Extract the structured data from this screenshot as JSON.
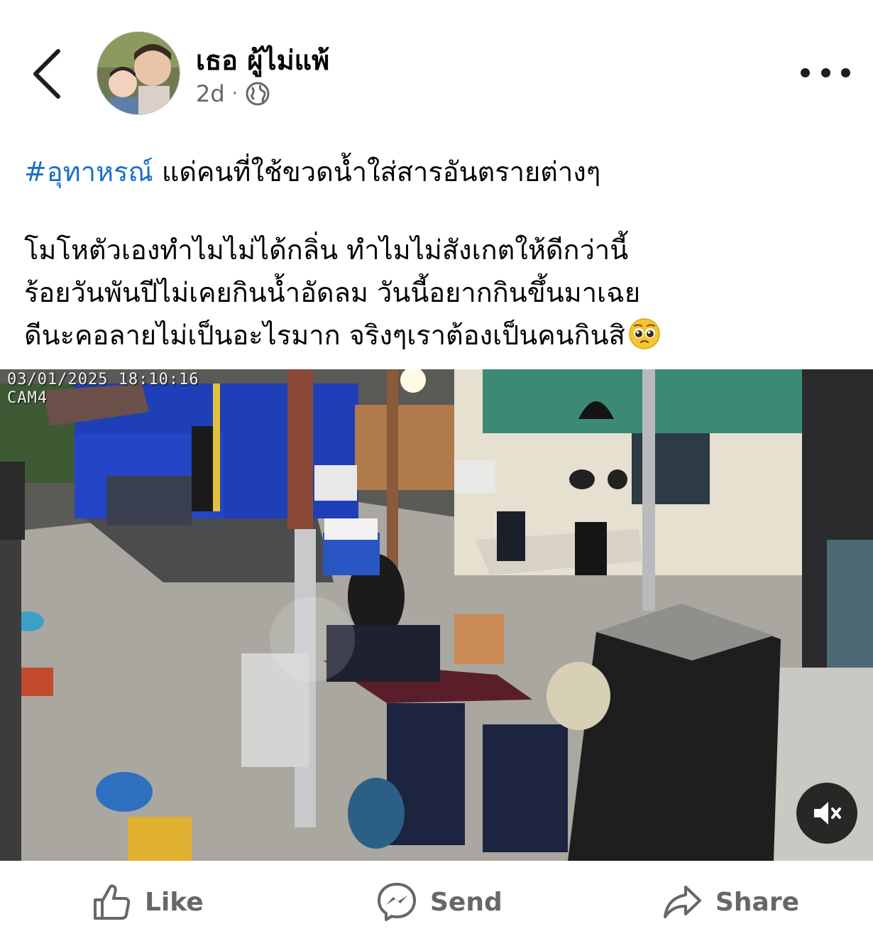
{
  "header": {
    "author_name": "เธอ ผู้ไม่แพ้",
    "timestamp": "2d",
    "separator": "·",
    "back_icon": "chevron-left-icon",
    "privacy_icon": "globe-icon",
    "more_icon": "more-horizontal-icon"
  },
  "post": {
    "hashtag": "#อุทาหรณ์",
    "line1_rest": " แด่คนที่ใช้ขวดน้ำใส่สารอันตรายต่างๆ",
    "line2": "โมโหตัวเองทำไมไม่ได้กลิ่น ทำไมไม่สังเกตให้ดีกว่านี้",
    "line3": "ร้อยวันพันปีไม่เคยกินน้ำอัดลม วันนี้อยากกินขึ้นมาเฉย",
    "line4": "ดีนะคอลายไม่เป็นอะไรมาก จริงๆเราต้องเป็นคนกินสิ",
    "emoji": "pleading-face-emoji"
  },
  "video": {
    "timestamp_overlay": "03/01/2025 18:10:16",
    "camera_label": "CAM4",
    "mute_icon": "speaker-muted-icon"
  },
  "actions": {
    "like_label": "Like",
    "send_label": "Send",
    "share_label": "Share",
    "like_icon": "thumbs-up-icon",
    "send_icon": "messenger-icon",
    "share_icon": "share-arrow-icon"
  },
  "colors": {
    "hashtag": "#1a6fc9",
    "action_text": "#65676b",
    "text": "#050505"
  }
}
